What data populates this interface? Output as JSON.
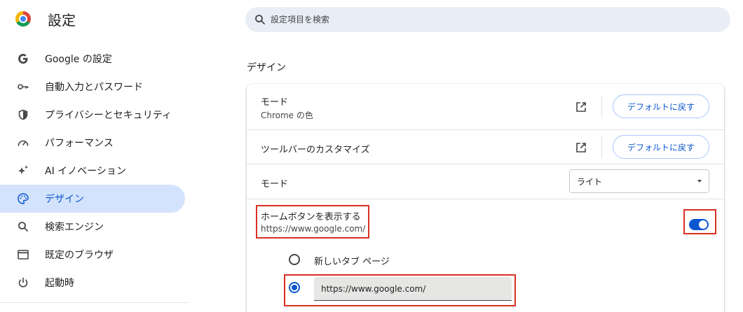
{
  "header": {
    "title": "設定",
    "search_placeholder": "設定項目を検索"
  },
  "sidebar": {
    "items": [
      {
        "label": "Google の設定",
        "icon": "google-g-icon",
        "active": false
      },
      {
        "label": "自動入力とパスワード",
        "icon": "key-icon",
        "active": false
      },
      {
        "label": "プライバシーとセキュリティ",
        "icon": "shield-icon",
        "active": false
      },
      {
        "label": "パフォーマンス",
        "icon": "speedometer-icon",
        "active": false
      },
      {
        "label": "AI イノベーション",
        "icon": "sparkle-icon",
        "active": false
      },
      {
        "label": "デザイン",
        "icon": "palette-icon",
        "active": true
      },
      {
        "label": "検索エンジン",
        "icon": "search-icon",
        "active": false
      },
      {
        "label": "既定のブラウザ",
        "icon": "browser-window-icon",
        "active": false
      },
      {
        "label": "起動時",
        "icon": "power-icon",
        "active": false
      }
    ]
  },
  "main": {
    "section_title": "デザイン",
    "rows": {
      "theme": {
        "label": "モード",
        "sub": "Chrome の色",
        "button": "デフォルトに戻す"
      },
      "toolbar": {
        "label": "ツールバーのカスタマイズ",
        "button": "デフォルトに戻す"
      },
      "mode": {
        "label": "モード",
        "value": "ライト"
      },
      "home": {
        "label": "ホームボタンを表示する",
        "sub": "https://www.google.com/",
        "enabled": true
      },
      "home_options": {
        "new_tab_label": "新しいタブ ページ",
        "custom_url": "https://www.google.com/",
        "selected": "custom_url"
      }
    }
  },
  "colors": {
    "accent": "#0b57d0",
    "active_nav_bg": "#d3e3fd",
    "highlight": "#d93025"
  }
}
